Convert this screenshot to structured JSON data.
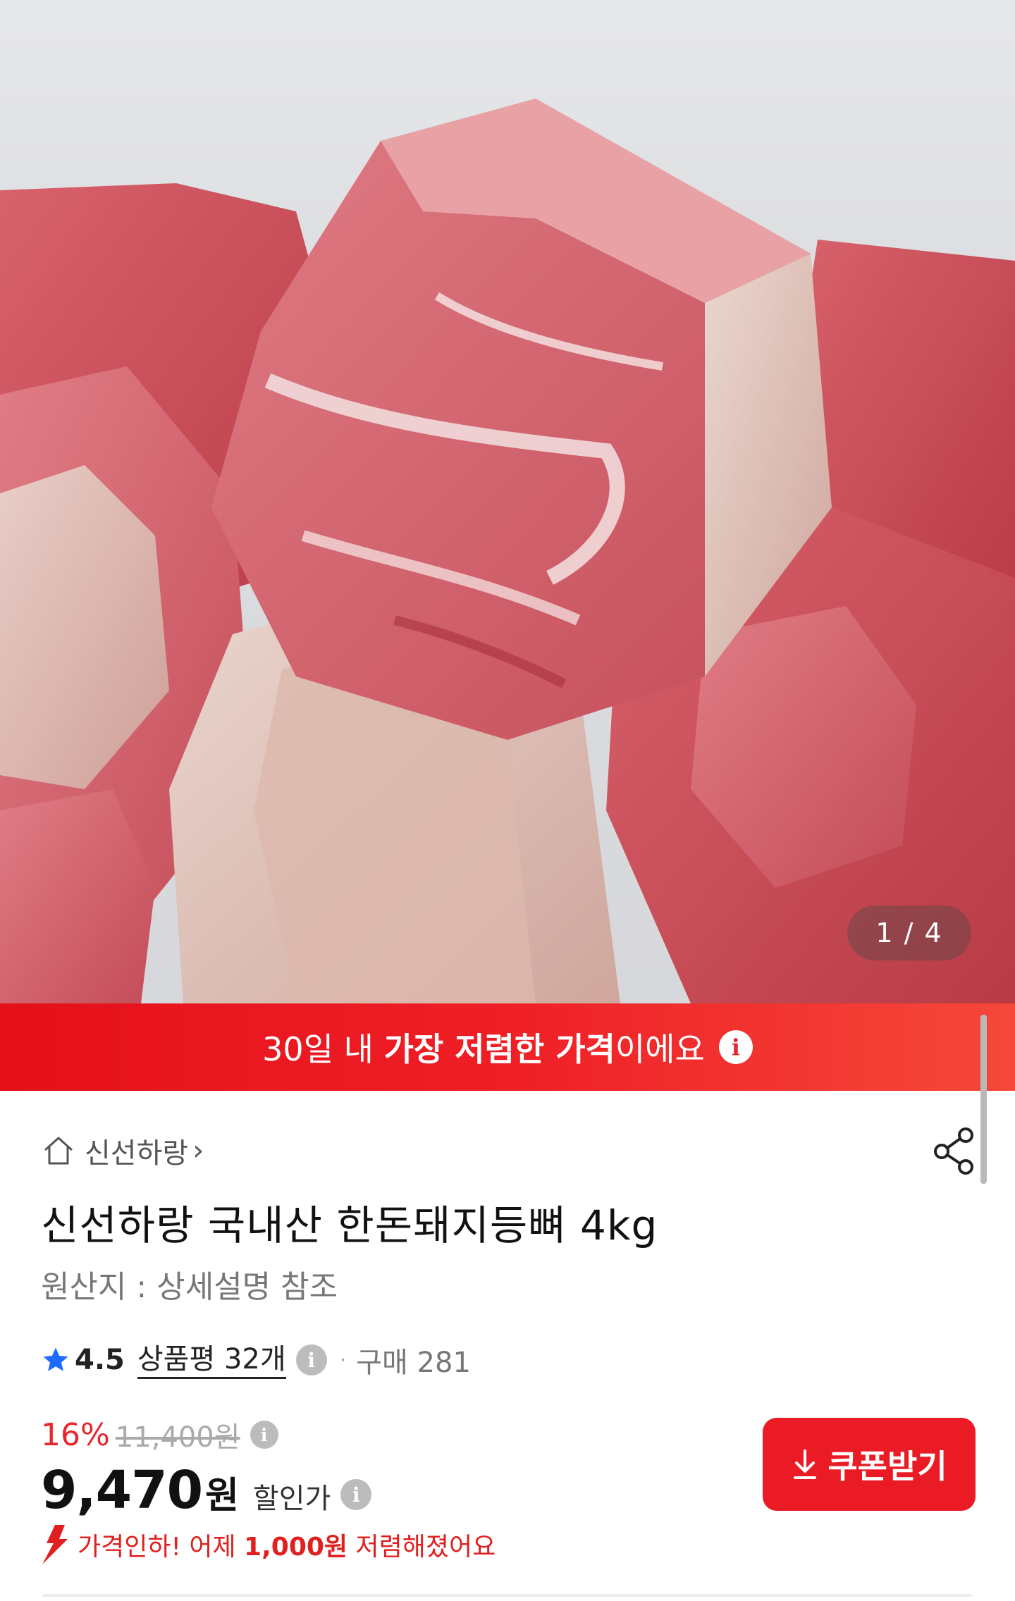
{
  "gallery": {
    "page_counter": "1 / 4",
    "image_subject": "raw pork back bones"
  },
  "banner": {
    "text_pre": "30일 내 ",
    "text_strong": "가장 저렴한 가격",
    "text_post": "이에요",
    "info_icon": "i"
  },
  "shop": {
    "name": "신선하랑",
    "chevron": "›",
    "home_icon": "home-icon",
    "share_icon": "share-icon"
  },
  "product": {
    "title": "신선하랑 국내산 한돈돼지등뼈 4kg",
    "origin": "원산지 : 상세설명 참조"
  },
  "rating": {
    "score": "4.5",
    "reviews_label": "상품평 32개",
    "info_icon": "i",
    "separator": "·",
    "purchases": "구매 281"
  },
  "price": {
    "discount_rate": "16%",
    "original_price": "11,400원",
    "sale_price": "9,470",
    "currency": "원",
    "sale_label": "할인가",
    "info_icon": "i"
  },
  "price_drop": {
    "text_pre": "가격인하! 어제 ",
    "amount": "1,000원",
    "text_post": " 저렴해졌어요"
  },
  "coupon": {
    "label": "쿠폰받기",
    "icon": "download-arrow-icon"
  },
  "colors": {
    "accent": "#ea1b24",
    "banner_gradient_end": "#f5483a",
    "muted_text": "#777777"
  }
}
